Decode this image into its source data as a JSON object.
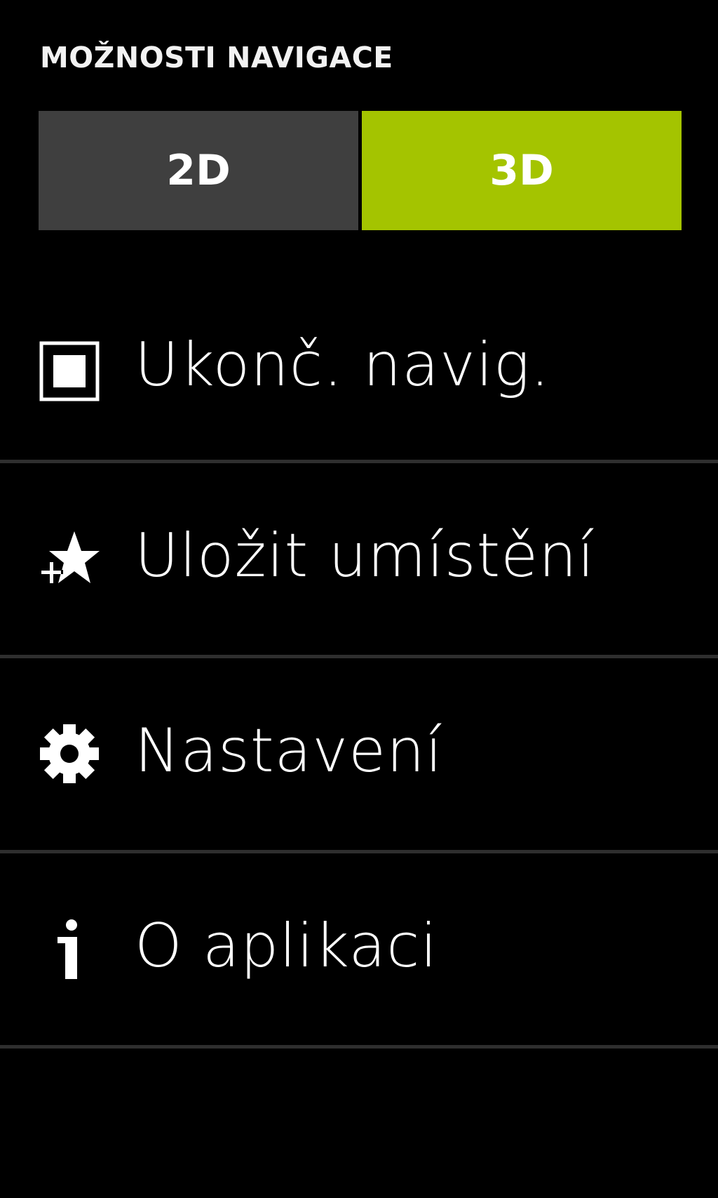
{
  "header": {
    "title": "MOŽNOSTI NAVIGACE"
  },
  "view_toggle": {
    "options": [
      {
        "label": "2D",
        "selected": false
      },
      {
        "label": "3D",
        "selected": true
      }
    ],
    "accent_color": "#a4c400",
    "inactive_color": "#3f3f3f"
  },
  "menu": {
    "items": [
      {
        "label": "Ukonč. navig.",
        "icon": "stop-icon"
      },
      {
        "label": "Uložit umístění",
        "icon": "star-add-icon"
      },
      {
        "label": "Nastavení",
        "icon": "gear-icon"
      },
      {
        "label": "O aplikaci",
        "icon": "info-icon"
      }
    ]
  }
}
